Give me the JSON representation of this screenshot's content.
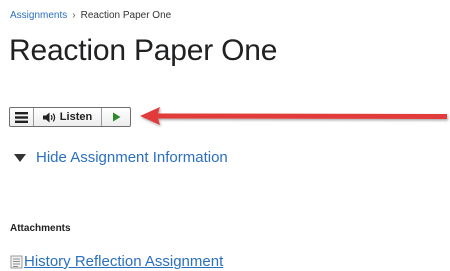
{
  "breadcrumb": {
    "parent": "Assignments",
    "separator": "›",
    "current": "Reaction Paper One"
  },
  "page_title": "Reaction Paper One",
  "readspeaker": {
    "listen_label": "Listen"
  },
  "info_toggle": {
    "label": "Hide Assignment Information"
  },
  "attachments": {
    "heading": "Attachments",
    "items": [
      {
        "label": "History Reflection Assignment"
      }
    ]
  },
  "colors": {
    "link": "#2a6fc1",
    "annotation_arrow": "#e23b3b",
    "play_icon": "#2b8a2b"
  }
}
